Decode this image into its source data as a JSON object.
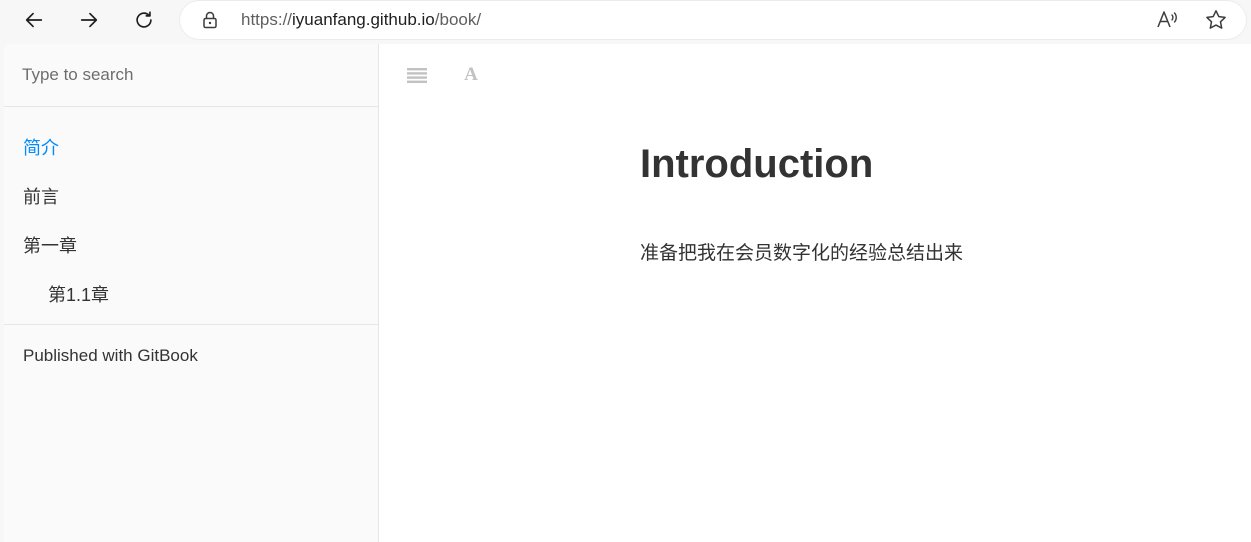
{
  "browser": {
    "url_prefix": "https://",
    "url_host": "iyuanfang.github.io",
    "url_path": "/book/",
    "icons": [
      "back-icon",
      "forward-icon",
      "refresh-icon",
      "lock-icon",
      "read-aloud-icon",
      "favorite-icon"
    ]
  },
  "sidebar": {
    "search_placeholder": "Type to search",
    "items": [
      {
        "label": "简介",
        "active": true,
        "level": 1
      },
      {
        "label": "前言",
        "active": false,
        "level": 1
      },
      {
        "label": "第一章",
        "active": false,
        "level": 1
      },
      {
        "label": "第1.1章",
        "active": false,
        "level": 2
      }
    ],
    "published_with": "Published with GitBook"
  },
  "toolbar": {
    "font_settings_glyph": "A",
    "icons": [
      "toggle-sidebar-icon",
      "font-settings-icon"
    ]
  },
  "content": {
    "title": "Introduction",
    "text": "准备把我在会员数字化的经验总结出来"
  },
  "colors": {
    "active_link": "#008cff",
    "text": "#333333",
    "toolbar_icon": "#c2c2c2"
  }
}
